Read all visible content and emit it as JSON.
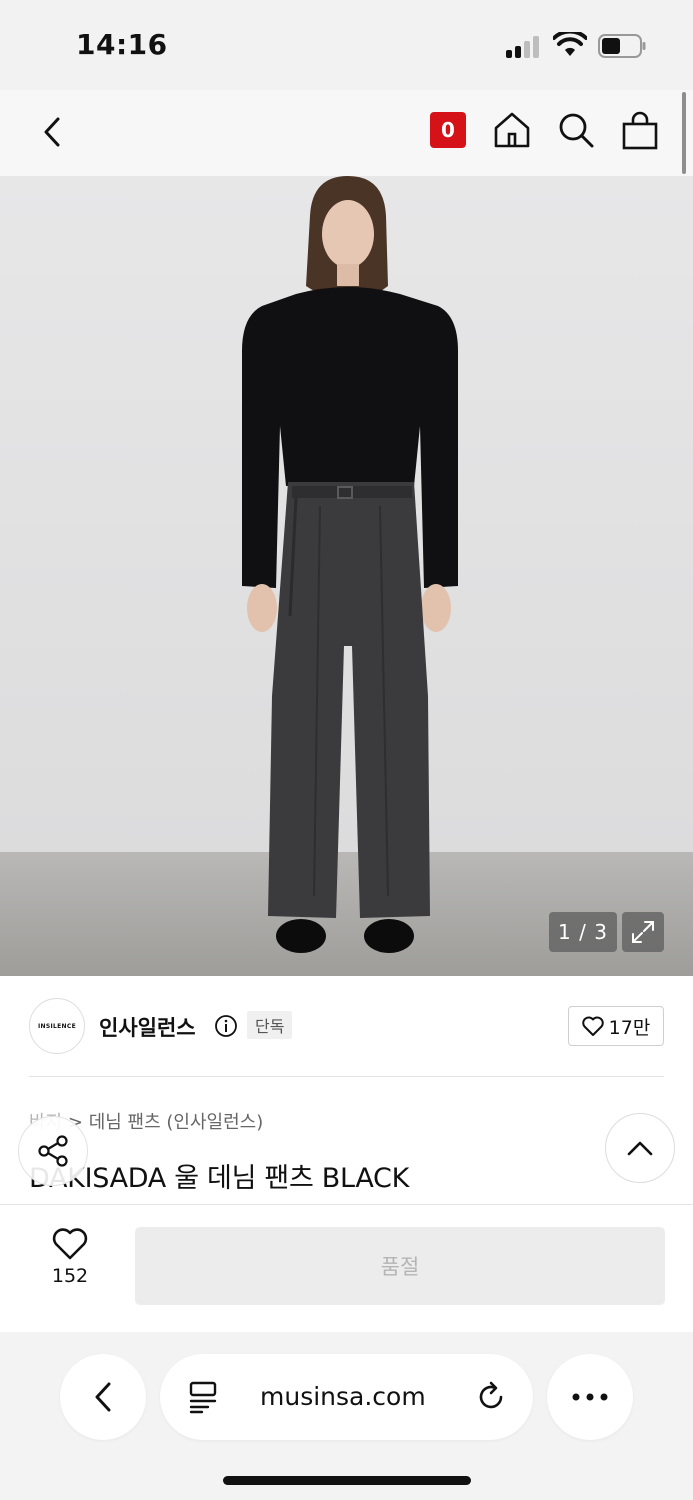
{
  "status_bar": {
    "time": "14:16"
  },
  "header": {
    "cart_count": "0"
  },
  "gallery": {
    "page_counter": "1 / 3"
  },
  "brand": {
    "logo_text": "INSILENCE",
    "name": "인사일런스",
    "exclusive_badge": "단독",
    "like_count": "17만"
  },
  "breadcrumb": {
    "category": "바지",
    "separator": ">",
    "subcategory": "데님 팬츠 (인사일런스)"
  },
  "product": {
    "title": "DAKISADA 울 데님 팬츠 BLACK"
  },
  "purchase": {
    "wish_count": "152",
    "soldout_label": "품절"
  },
  "browser": {
    "url": "musinsa.com"
  },
  "colors": {
    "accent_red": "#d41217",
    "soldout_bg": "#ececec"
  }
}
